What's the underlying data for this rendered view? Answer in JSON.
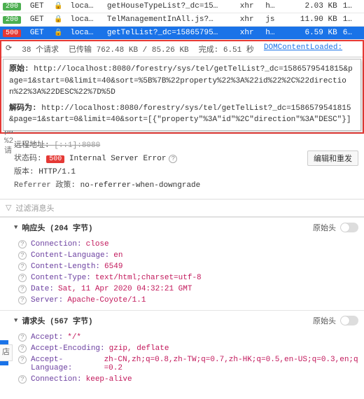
{
  "rows": [
    {
      "status": "200",
      "cls": "s200",
      "method": "GET",
      "domain": "loca…",
      "file": "getHouseTypeList?_dc=15…",
      "type": "xhr",
      "init": "h…",
      "size": "2.03 KB"
    },
    {
      "status": "200",
      "cls": "s200",
      "method": "GET",
      "domain": "loca…",
      "file": "TelManagementInAll.js?…",
      "type": "xhr",
      "init": "js",
      "size": "11.90 KB"
    },
    {
      "status": "500",
      "cls": "s500",
      "method": "GET",
      "domain": "loca…",
      "file": "getTelList?_dc=15865795…",
      "type": "xhr",
      "init": "h…",
      "size": "6.59 KB",
      "time": "6…",
      "sel": true
    }
  ],
  "summary": {
    "clock": "⟳",
    "requests": "38 个请求",
    "transferred": "已传输 762.48 KB / 85.26 KB",
    "finish": "完成: 6.51 秒",
    "dom": "DOMContentLoaded:"
  },
  "popup": {
    "l1_label": "原始:",
    "l1": "http://localhost:8080/forestry/sys/tel/getTelList?_dc=1586579541815&page=1&start=0&limit=40&sort=%5B%7B%22property%22%3A%22id%22%2C%22direction%22%3A%22DESC%22%7D%5D",
    "l2_label": "解码为:",
    "l2": "http://localhost:8080/forestry/sys/tel/getTelList?_dc=1586579541815&page=1&start=0&limit=40&sort=[{\"property\"%3A\"id\"%2C\"direction\"%3A\"DESC\"}]"
  },
  "side": {
    "a": "请",
    "b": "pa",
    "c": "%2",
    "d": "请"
  },
  "remote": {
    "label": "远程地址:",
    "value": "[::1]:8080"
  },
  "statusLine": {
    "label": "状态码:",
    "code": "500",
    "text": "Internal Server Error"
  },
  "version": {
    "label": "版本:",
    "value": "HTTP/1.1"
  },
  "referrer": {
    "label": "Referrer 政策:",
    "value": "no-referrer-when-downgrade"
  },
  "editBtn": "编辑和重发",
  "filter": "过滤消息头",
  "sections": {
    "resp": "响应头 (204 字节)",
    "req": "请求头 (567 字节)",
    "raw": "原始头"
  },
  "respHeaders": [
    {
      "k": "Connection:",
      "v": "close"
    },
    {
      "k": "Content-Language:",
      "v": "en"
    },
    {
      "k": "Content-Length:",
      "v": "6549"
    },
    {
      "k": "Content-Type:",
      "v": "text/html;charset=utf-8"
    },
    {
      "k": "Date:",
      "v": "Sat, 11 Apr 2020 04:32:21 GMT"
    },
    {
      "k": "Server:",
      "v": "Apache-Coyote/1.1"
    }
  ],
  "reqHeaders": [
    {
      "k": "Accept:",
      "v": "*/*"
    },
    {
      "k": "Accept-Encoding:",
      "v": "gzip, deflate"
    },
    {
      "k": "Accept-Language:",
      "v": "zh-CN,zh;q=0.8,zh-TW;q=0.7,zh-HK;q=0.5,en-US;q=0.3,en;q=0.2"
    },
    {
      "k": "Connection:",
      "v": "keep-alive"
    }
  ],
  "leftTab": "店"
}
